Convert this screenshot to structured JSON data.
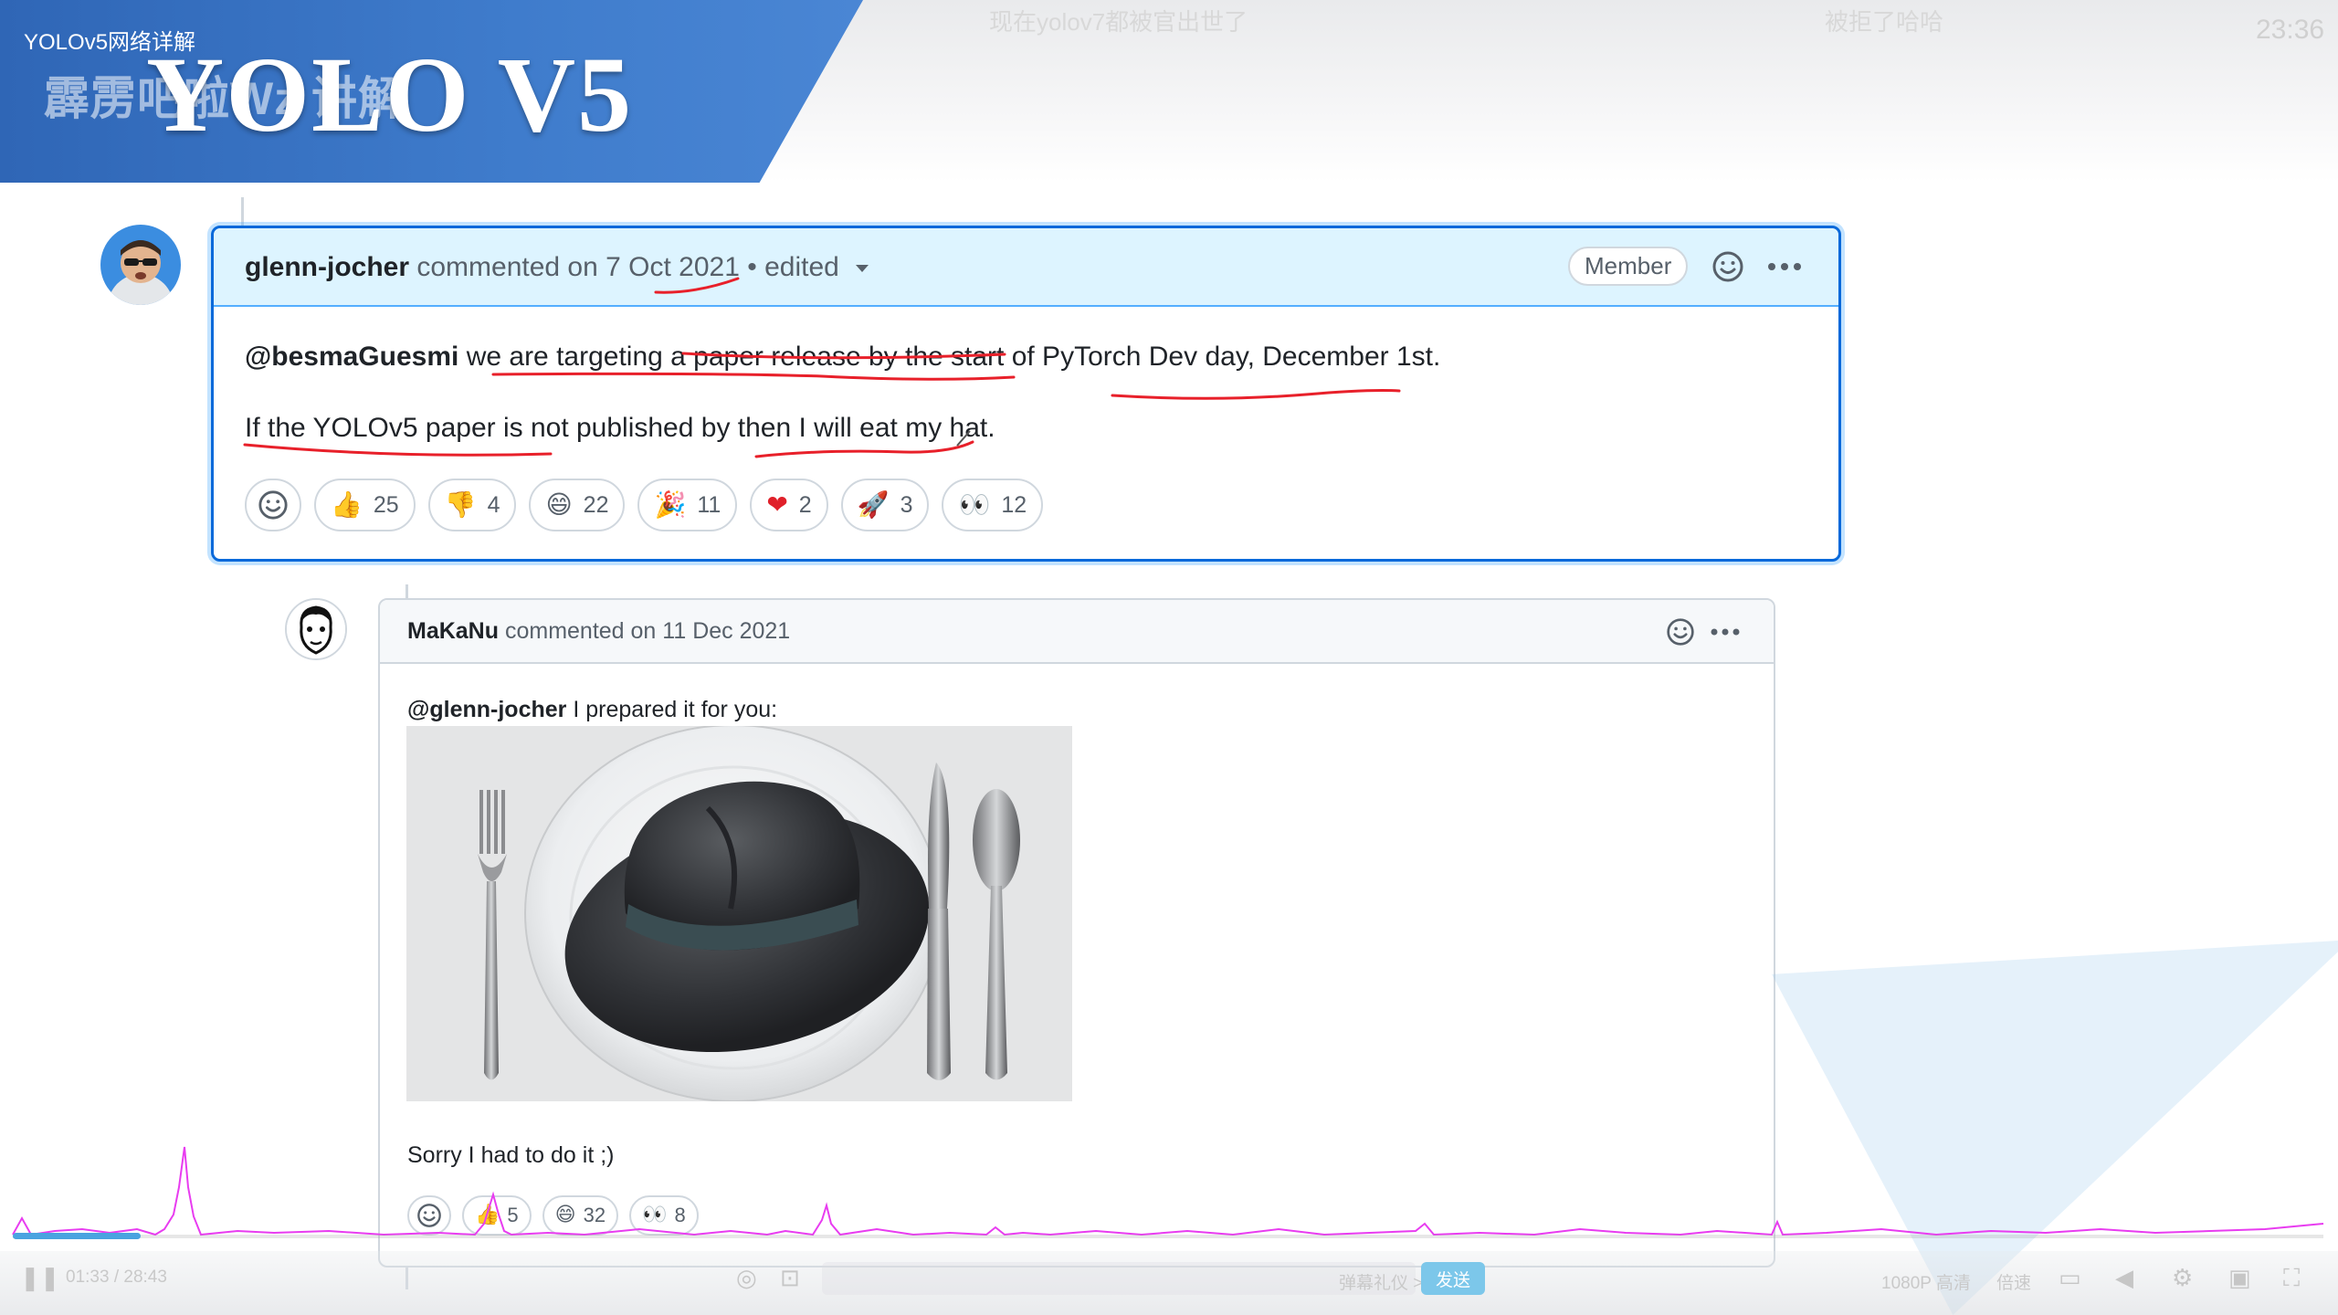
{
  "video": {
    "series_title": "YOLOv5网络详解",
    "watermark": "霹雳吧啦Wz 讲解",
    "big_title": "YOLO V5",
    "danmaku": [
      "现在yolov7都被官出世了",
      "被拒了哈哈"
    ],
    "clock": "23:36"
  },
  "comment1": {
    "author": "glenn-jocher",
    "action": "commented on",
    "date": "7 Oct 2021",
    "edited": "• edited",
    "badge": "Member",
    "line1_mention": "@besmaGuesmi",
    "line1_rest": " we are targeting a paper release by the start of PyTorch Dev day, December 1st.",
    "line2": "If the YOLOv5 paper is not published by then I will eat my hat.",
    "reactions": [
      {
        "emoji": "👍",
        "name": "thumbs-up-reaction",
        "count": "25"
      },
      {
        "emoji": "👎",
        "name": "thumbs-down-reaction",
        "count": "4"
      },
      {
        "emoji": "😄",
        "name": "laugh-reaction",
        "count": "22"
      },
      {
        "emoji": "🎉",
        "name": "hooray-reaction",
        "count": "11"
      },
      {
        "emoji": "❤",
        "name": "heart-reaction",
        "count": "2"
      },
      {
        "emoji": "🚀",
        "name": "rocket-reaction",
        "count": "3"
      },
      {
        "emoji": "👀",
        "name": "eyes-reaction",
        "count": "12"
      }
    ]
  },
  "comment2": {
    "author": "MaKaNu",
    "action": "commented on",
    "date": "11 Dec 2021",
    "mention": "@glenn-jocher",
    "body_rest": " I prepared it for you:",
    "closing": "Sorry I had to do it ;)",
    "reactions": [
      {
        "emoji": "👍",
        "name": "thumbs-up-reaction",
        "count": "5"
      },
      {
        "emoji": "😄",
        "name": "laugh-reaction",
        "count": "32"
      },
      {
        "emoji": "👀",
        "name": "eyes-reaction",
        "count": "8"
      }
    ]
  },
  "player": {
    "time": "01:33 / 28:43",
    "send_label": "发送",
    "quality": "1080P 高清",
    "speed": "倍速",
    "danmaku_settings": "弹幕礼仪 >"
  },
  "colors": {
    "banner_blue": "#3a74c4",
    "highlight_border": "#0969da",
    "annotation_red": "#e8202a",
    "waveform_pink": "#e83cf0",
    "send_button": "#7cc7ea"
  },
  "icons": [
    "smiley-icon",
    "kebab-menu-icon",
    "caret-down-icon",
    "pause-icon",
    "danmaku-icon",
    "settings-icon",
    "fullscreen-icon",
    "volume-icon"
  ]
}
